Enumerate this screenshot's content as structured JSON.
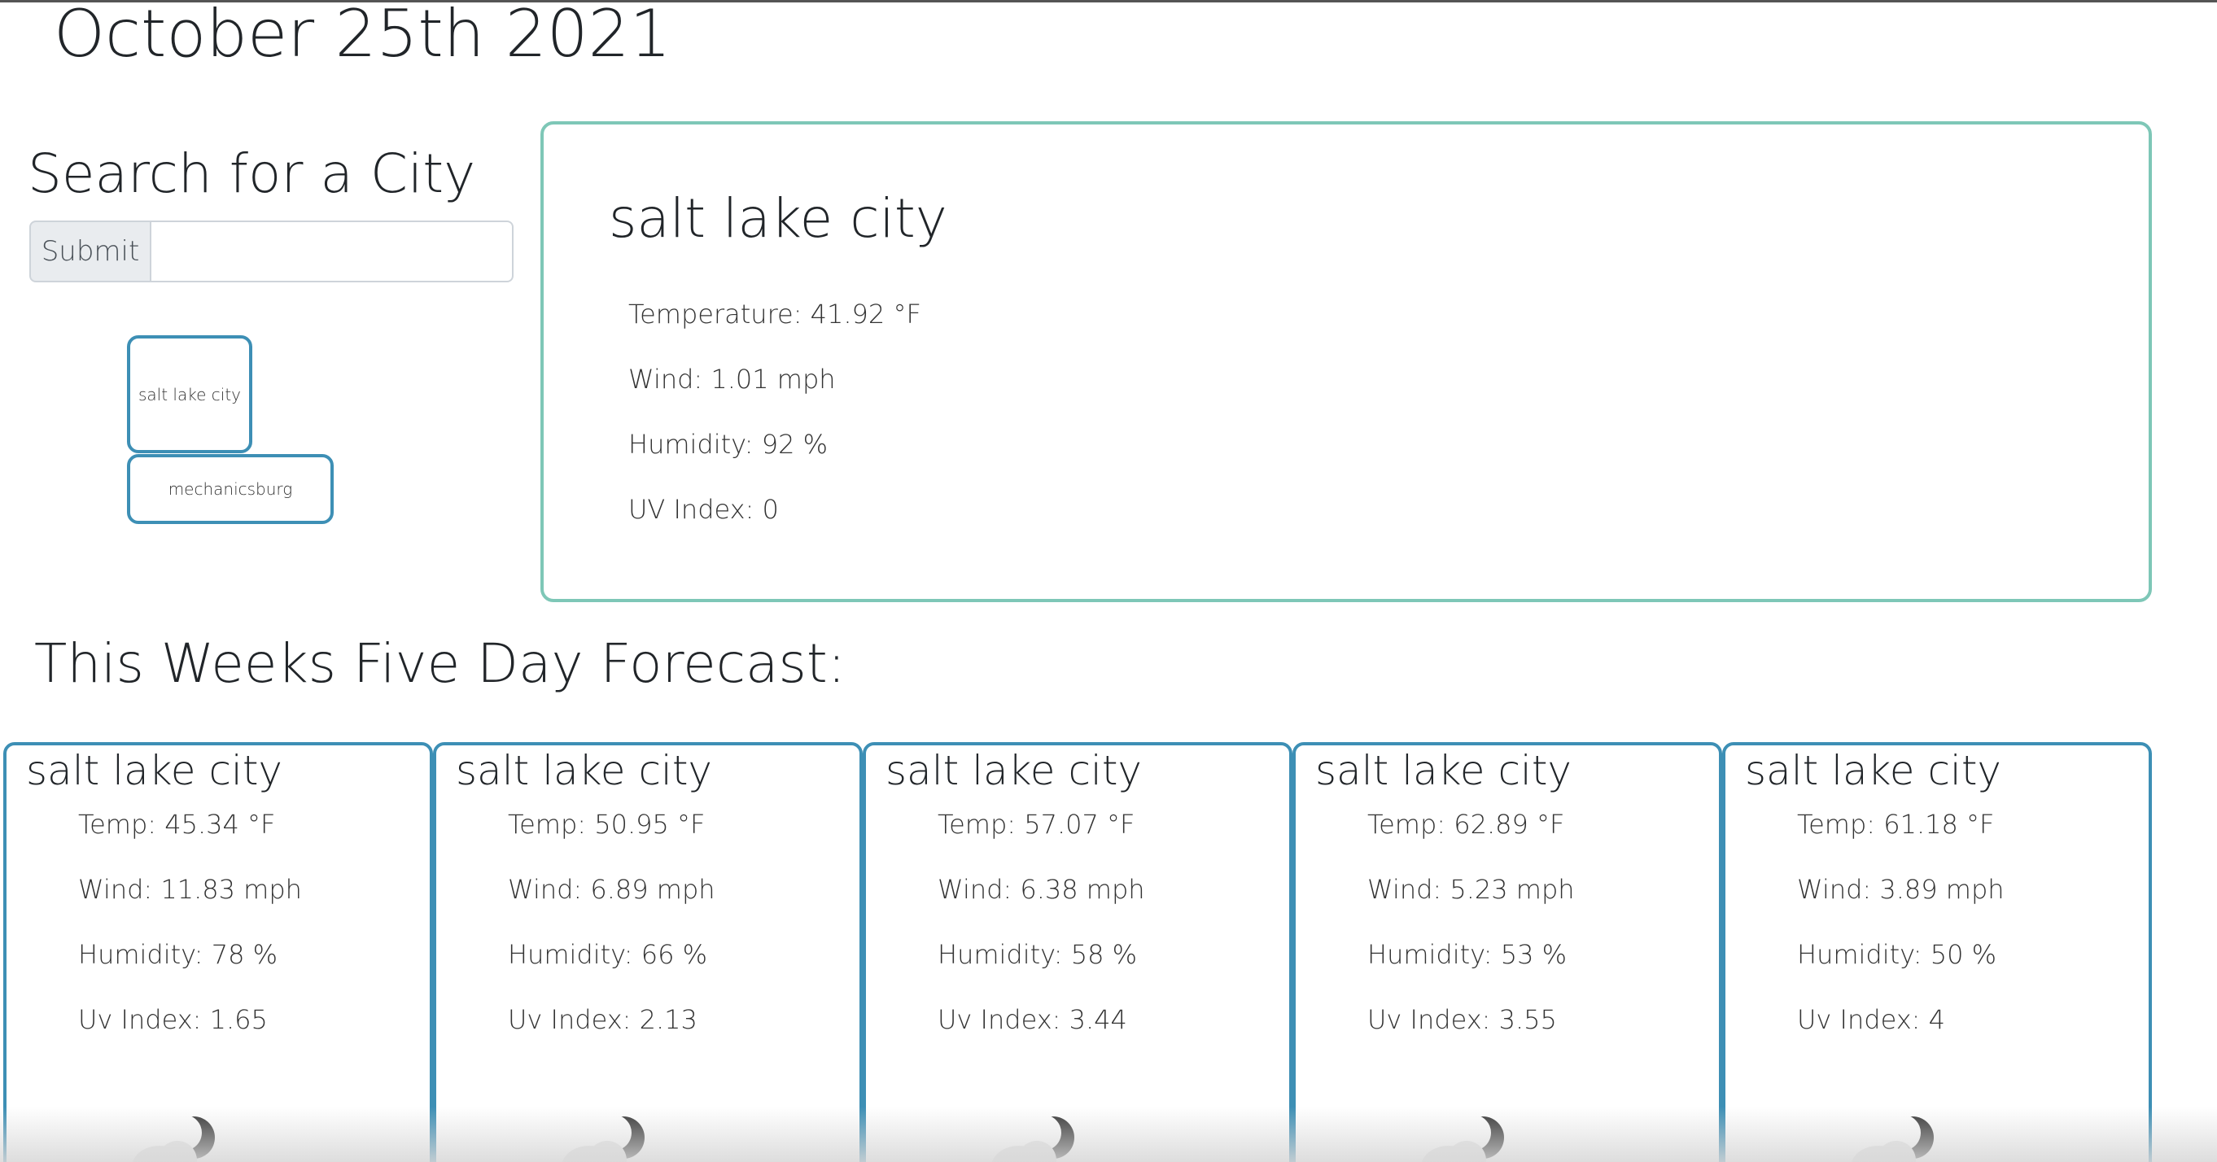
{
  "date": "October 25th 2021",
  "search": {
    "heading": "Search for a City",
    "submit_label": "Submit",
    "input_value": "",
    "placeholder": ""
  },
  "history": [
    {
      "label": "salt lake city"
    },
    {
      "label": "mechanicsburg"
    }
  ],
  "current": {
    "city": "salt lake city",
    "temperature": "Temperature: 41.92 °F",
    "wind": "Wind: 1.01 mph",
    "humidity": "Humidity: 92 %",
    "uv": "UV Index: 0"
  },
  "forecast_heading": "This Weeks Five Day Forecast:",
  "forecast": [
    {
      "city": "salt lake city",
      "temp": "Temp: 45.34 °F",
      "wind": "Wind: 11.83 mph",
      "humidity": "Humidity: 78 %",
      "uv": "Uv Index: 1.65",
      "icon": "cloud-moon-icon"
    },
    {
      "city": "salt lake city",
      "temp": "Temp: 50.95 °F",
      "wind": "Wind: 6.89 mph",
      "humidity": "Humidity: 66 %",
      "uv": "Uv Index: 2.13",
      "icon": "cloud-moon-icon"
    },
    {
      "city": "salt lake city",
      "temp": "Temp: 57.07 °F",
      "wind": "Wind: 6.38 mph",
      "humidity": "Humidity: 58 %",
      "uv": "Uv Index: 3.44",
      "icon": "cloud-moon-icon"
    },
    {
      "city": "salt lake city",
      "temp": "Temp: 62.89 °F",
      "wind": "Wind: 5.23 mph",
      "humidity": "Humidity: 53 %",
      "uv": "Uv Index: 3.55",
      "icon": "cloud-moon-icon"
    },
    {
      "city": "salt lake city",
      "temp": "Temp: 61.18 °F",
      "wind": "Wind: 3.89 mph",
      "humidity": "Humidity: 50 %",
      "uv": "Uv Index: 4",
      "icon": "cloud-moon-icon"
    }
  ],
  "colors": {
    "history_border": "#3d8fb5",
    "current_border": "#7ec7b7",
    "forecast_border": "#3d8fb5",
    "submit_bg": "#e9ecef"
  }
}
